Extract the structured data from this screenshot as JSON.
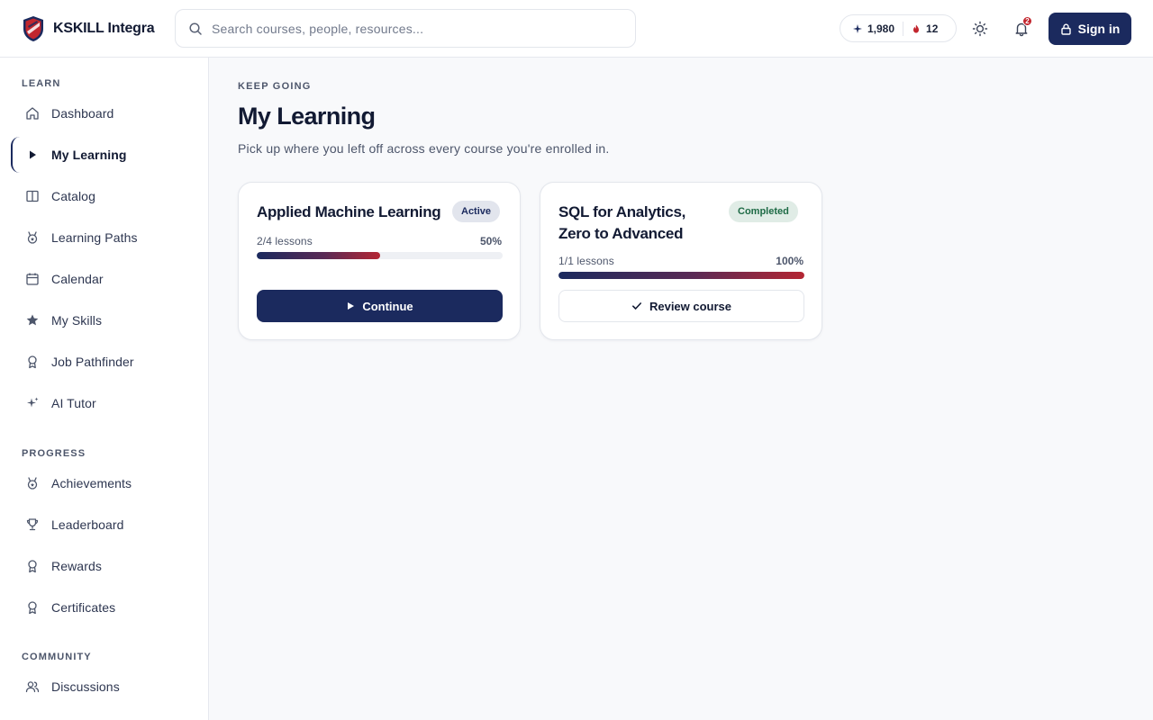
{
  "app": {
    "name": "KSKILL Integra"
  },
  "header": {
    "search_placeholder": "Search courses, people, resources...",
    "points": "1,980",
    "streak": "12",
    "notifications_count": "2",
    "sign_in_label": "Sign in"
  },
  "sidebar": {
    "sections": [
      {
        "title": "LEARN",
        "items": [
          {
            "label": "Dashboard",
            "icon": "home-icon"
          },
          {
            "label": "My Learning",
            "icon": "play-icon",
            "active": true
          },
          {
            "label": "Catalog",
            "icon": "book-icon"
          },
          {
            "label": "Learning Paths",
            "icon": "medal-icon"
          },
          {
            "label": "Calendar",
            "icon": "calendar-icon"
          },
          {
            "label": "My Skills",
            "icon": "star-icon"
          },
          {
            "label": "Job Pathfinder",
            "icon": "award-icon"
          },
          {
            "label": "AI Tutor",
            "icon": "sparkle-icon"
          }
        ]
      },
      {
        "title": "PROGRESS",
        "items": [
          {
            "label": "Achievements",
            "icon": "medal-icon"
          },
          {
            "label": "Leaderboard",
            "icon": "trophy-icon"
          },
          {
            "label": "Rewards",
            "icon": "award-icon"
          },
          {
            "label": "Certificates",
            "icon": "award-icon"
          }
        ]
      },
      {
        "title": "COMMUNITY",
        "items": [
          {
            "label": "Discussions",
            "icon": "users-icon"
          }
        ]
      }
    ]
  },
  "main": {
    "eyebrow": "KEEP GOING",
    "title": "My Learning",
    "subtitle": "Pick up where you left off across every course you're enrolled in.",
    "courses": [
      {
        "title": "Applied Machine Learning",
        "status": "Active",
        "lessons": "2/4 lessons",
        "percent_label": "50%",
        "progress": 0.5,
        "action_label": "Continue"
      },
      {
        "title": "SQL for Analytics, Zero to Advanced",
        "status": "Completed",
        "lessons": "1/1 lessons",
        "percent_label": "100%",
        "progress": 1.0,
        "action_label": "Review course"
      }
    ]
  },
  "colors": {
    "brand_navy": "#1b2a5e",
    "brand_red": "#b42633",
    "completed_green": "#1d6a45"
  }
}
